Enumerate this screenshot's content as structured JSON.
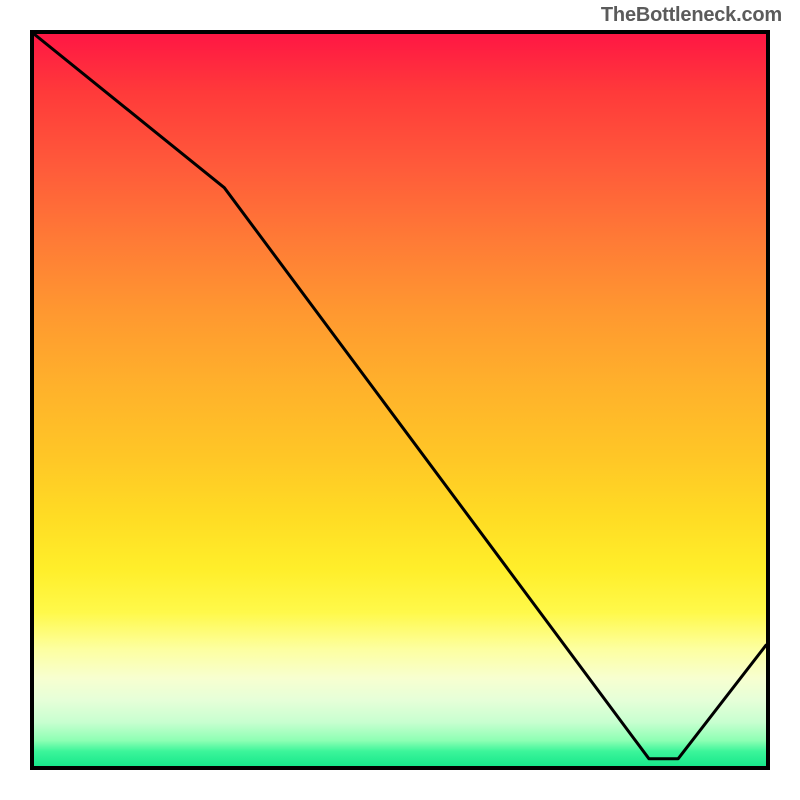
{
  "attribution": "TheBottleneck.com",
  "optimal_label": "",
  "chart_data": {
    "type": "line",
    "title": "",
    "xlabel": "",
    "ylabel": "",
    "x_range_fraction": [
      0,
      1
    ],
    "y_range_fraction": [
      0,
      1
    ],
    "series": [
      {
        "name": "bottleneck-curve",
        "points_fraction": [
          {
            "x": 0.0,
            "y": 1.0
          },
          {
            "x": 0.26,
            "y": 0.79
          },
          {
            "x": 0.84,
            "y": 0.01
          },
          {
            "x": 0.88,
            "y": 0.01
          },
          {
            "x": 1.0,
            "y": 0.165
          }
        ]
      }
    ],
    "optimal_zone_x_fraction": [
      0.78,
      0.9
    ],
    "background_gradient": [
      "#ff1744",
      "#ff9830",
      "#ffee2a",
      "#17e88b"
    ]
  }
}
